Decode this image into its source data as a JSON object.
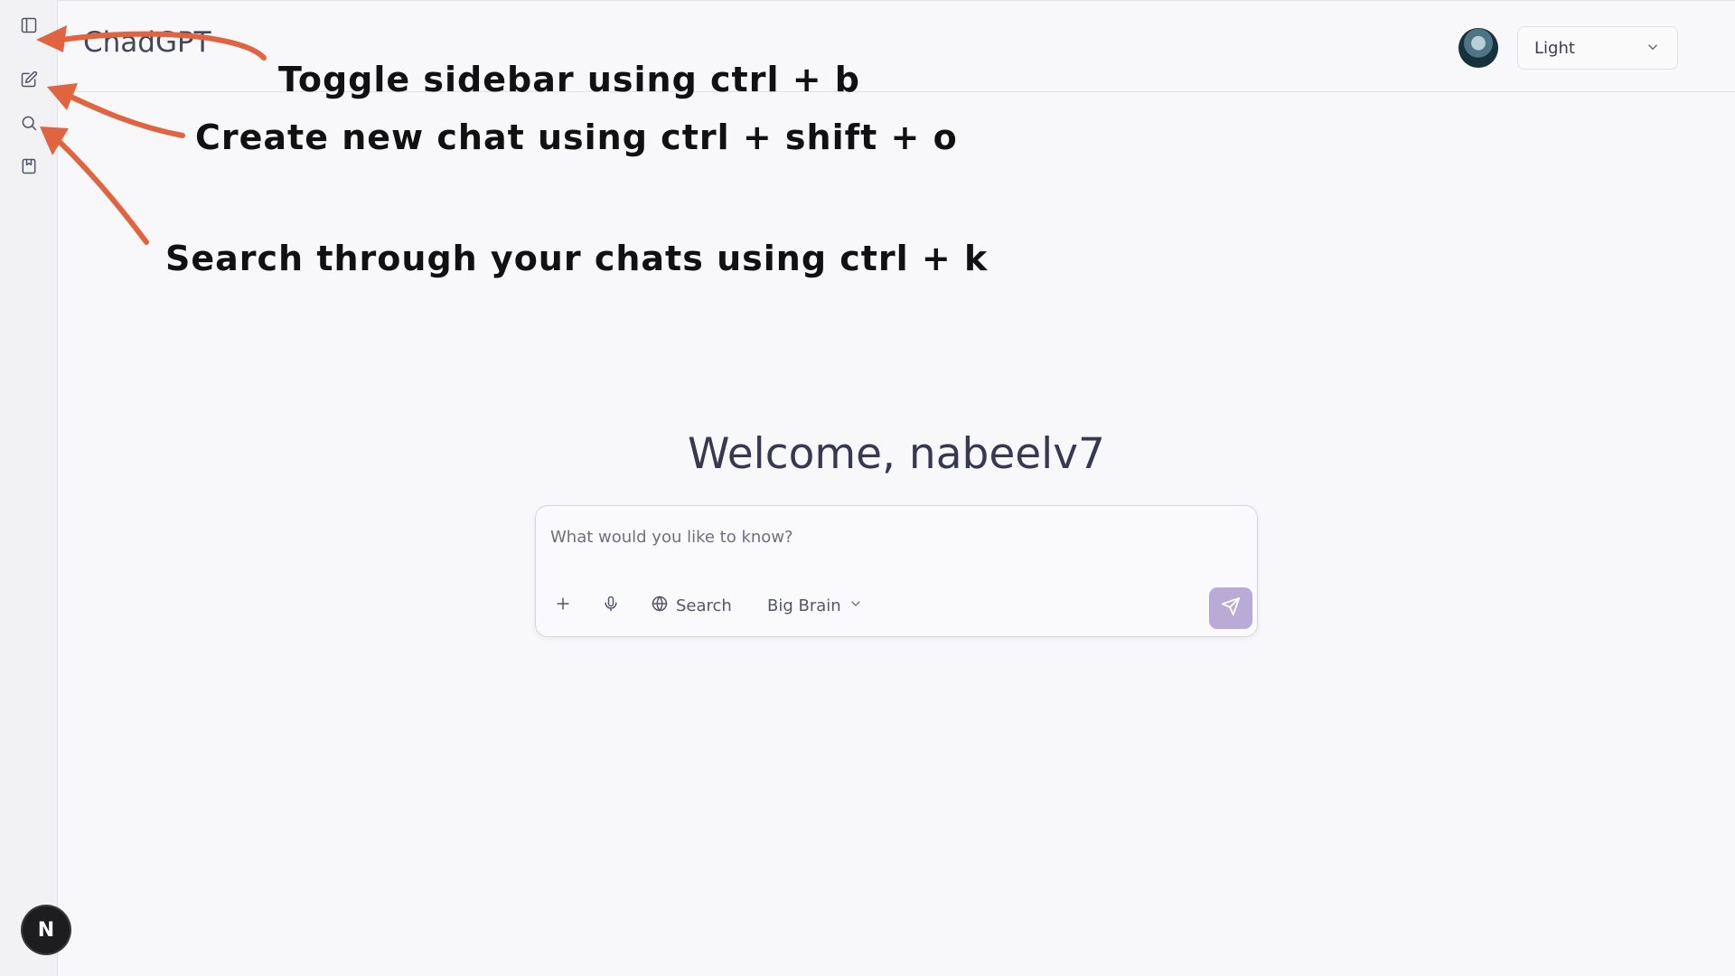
{
  "app": {
    "brand": "ChadGPT"
  },
  "sidebar": {
    "items": [
      {
        "name": "toggle-sidebar",
        "icon": "sidebar-icon"
      },
      {
        "name": "new-chat",
        "icon": "edit-icon"
      },
      {
        "name": "search",
        "icon": "search-icon"
      },
      {
        "name": "library",
        "icon": "bookmark-icon"
      }
    ],
    "bottom_badge": "N"
  },
  "header": {
    "theme_select_value": "Light"
  },
  "main": {
    "welcome": "Welcome, nabeelv7",
    "composer": {
      "placeholder": "What would you like to know?",
      "search_label": "Search",
      "model_label": "Big Brain"
    }
  },
  "annotations": [
    "Toggle sidebar using ctrl + b",
    "Create new chat using ctrl + shift + o",
    "Search through your chats using ctrl + k"
  ],
  "colors": {
    "accent": "#b9aad6",
    "arrow": "#e0643f",
    "background": "#f8f8fa"
  }
}
